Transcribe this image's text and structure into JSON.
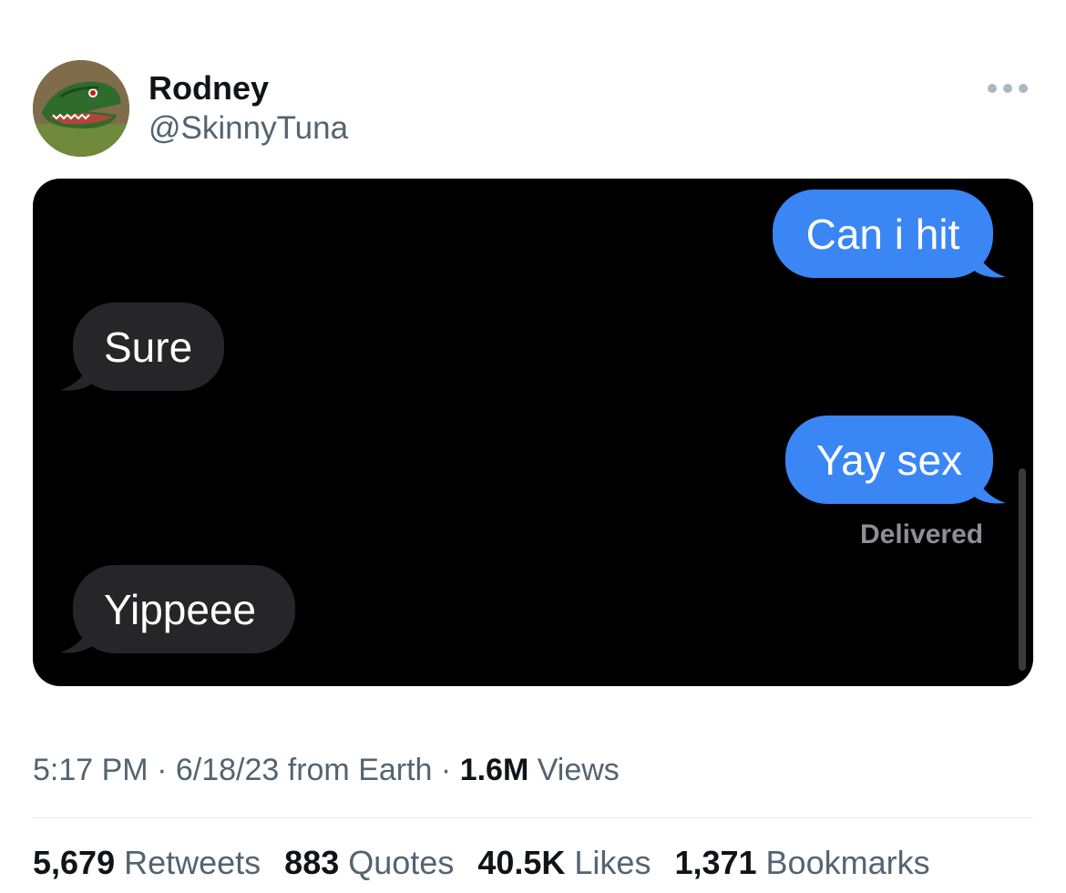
{
  "author": {
    "name": "Rodney",
    "handle": "@SkinnyTuna"
  },
  "icons": {
    "avatar": "dinosaur-avatar-icon",
    "more": "more-options-icon"
  },
  "conversation": {
    "messages": [
      {
        "text": "Can i hit",
        "side": "sent"
      },
      {
        "text": "Sure",
        "side": "received"
      },
      {
        "text": "Yay sex",
        "side": "sent"
      },
      {
        "text": "Yippeee",
        "side": "received"
      }
    ],
    "status": "Delivered"
  },
  "meta": {
    "time": "5:17 PM",
    "sep1": " · ",
    "date": "6/18/23",
    "source": " from Earth",
    "sep2": " · ",
    "views_count": "1.6M",
    "views_label": " Views"
  },
  "stats": {
    "retweets_count": "5,679",
    "retweets_label": " Retweets",
    "quotes_count": "883",
    "quotes_label": " Quotes",
    "likes_count": "40.5K",
    "likes_label": " Likes",
    "bookmarks_count": "1,371",
    "bookmarks_label": " Bookmarks"
  },
  "colors": {
    "sent_bubble": "#3a86f5",
    "received_bubble": "#262629",
    "media_background": "#000000"
  }
}
